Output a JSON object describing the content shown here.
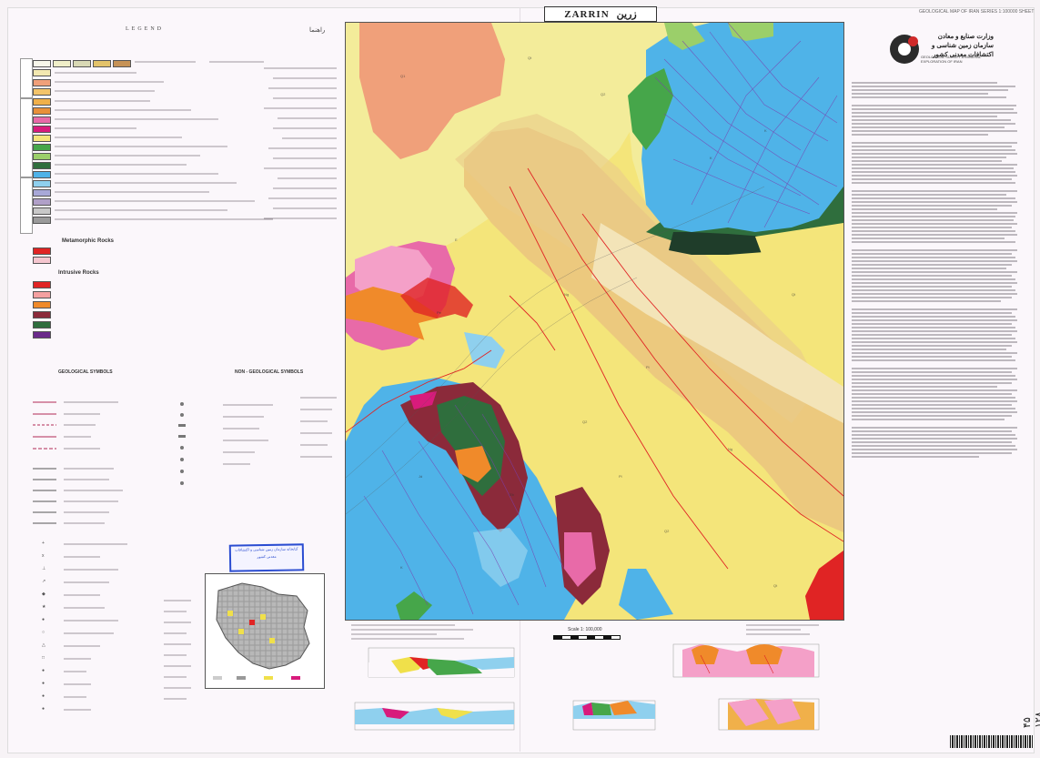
{
  "header": {
    "title_en": "ZARRIN",
    "title_fa": "زرین",
    "series_title": "GEOLOGICAL MAP OF IRAN SERIES 1:100000 SHEET"
  },
  "agency": {
    "name_fa": "وزارت صنایع و معادن سازمان زمین شناسی و اکتشافات معدنی کشور",
    "name_en": "GEOLOGICAL SURVEY & MINERAL EXPLORATION OF IRAN"
  },
  "legend": {
    "title_en": "LEGEND",
    "title_fa": "راهنما",
    "section_metamorphic": "Metamorphic Rocks",
    "section_intrusive": "Intrusive Rocks",
    "section_geo_symbols": "GEOLOGICAL SYMBOLS",
    "section_non_geo_symbols": "NON - GEOLOGICAL SYMBOLS",
    "colors": {
      "yellow": "#f4e57a",
      "tan": "#ecc97e",
      "light_tan": "#f3e4b8",
      "salmon": "#f0a07a",
      "blue": "#4fb3e8",
      "light_blue": "#8fd0ee",
      "dark_green": "#2f6e3d",
      "green": "#46a64a",
      "maroon": "#8b2a3a",
      "pink": "#e86aa8",
      "magenta": "#d81b7c",
      "orange": "#f08a2a",
      "red": "#e02424",
      "purple": "#6a2a8a",
      "gray": "#9a9a9a"
    }
  },
  "stamp_text": "کتابخانه سازمان زمین شناسی و اکتشافات معدنی کشور",
  "scale": {
    "label": "Scale 1: 100,000"
  },
  "side_text": "۴۵ ۱۲۸"
}
